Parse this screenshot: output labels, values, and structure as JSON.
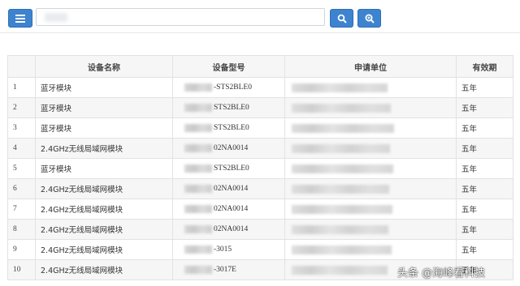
{
  "toolbar": {
    "menu_icon": "hamburger-menu-icon",
    "search_icon": "search-icon",
    "advanced_search_icon": "zoom-in-icon",
    "accent_color": "#3d83cf"
  },
  "table": {
    "headers": [
      "",
      "设备名称",
      "设备型号",
      "申请单位",
      "有效期"
    ],
    "rows": [
      {
        "num": "1",
        "name": "蓝牙模块",
        "model": "-STS2BLE0",
        "unit": "",
        "validity": "五年"
      },
      {
        "num": "2",
        "name": "蓝牙模块",
        "model": "STS2BLE0",
        "unit": "",
        "validity": "五年"
      },
      {
        "num": "3",
        "name": "蓝牙模块",
        "model": "STS2BLE0",
        "unit": "",
        "validity": "五年"
      },
      {
        "num": "4",
        "name": "2.4GHz无线局域网模块",
        "model": "02NA0014",
        "unit": "",
        "validity": "五年"
      },
      {
        "num": "5",
        "name": "蓝牙模块",
        "model": "STS2BLE0",
        "unit": "",
        "validity": "五年"
      },
      {
        "num": "6",
        "name": "2.4GHz无线局域网模块",
        "model": "02NA0014",
        "unit": "",
        "validity": "五年"
      },
      {
        "num": "7",
        "name": "2.4GHz无线局域网模块",
        "model": "02NA0014",
        "unit": "",
        "validity": "五年"
      },
      {
        "num": "8",
        "name": "2.4GHz无线局域网模块",
        "model": "02NA0014",
        "unit": "",
        "validity": "五年"
      },
      {
        "num": "9",
        "name": "2.4GHz无线局域网模块",
        "model": "-3015",
        "unit": "",
        "validity": "五年"
      },
      {
        "num": "10",
        "name": "2.4GHz无线局域网模块",
        "model": "-3017E",
        "unit": "",
        "validity": "五年"
      }
    ]
  },
  "watermark": "头条 @海峰看科技"
}
